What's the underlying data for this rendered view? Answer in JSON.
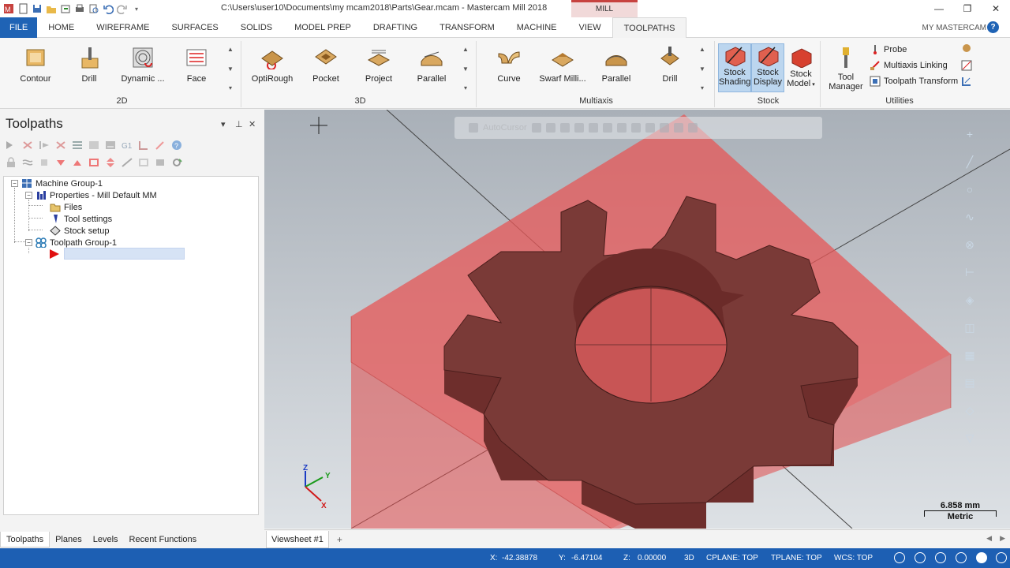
{
  "titlebar": {
    "path": "C:\\Users\\user10\\Documents\\my mcam2018\\Parts\\Gear.mcam - Mastercam Mill 2018",
    "context_tab": "MILL",
    "window_controls": [
      "—",
      "❐",
      "✕"
    ]
  },
  "tabs": [
    "FILE",
    "HOME",
    "WIREFRAME",
    "SURFACES",
    "SOLIDS",
    "MODEL PREP",
    "DRAFTING",
    "TRANSFORM",
    "MACHINE",
    "VIEW",
    "TOOLPATHS"
  ],
  "active_tab": "TOOLPATHS",
  "my_mastercam": "MY MASTERCAM",
  "ribbon": {
    "group_2d": {
      "label": "2D",
      "buttons": [
        "Contour",
        "Drill",
        "Dynamic ...",
        "Face"
      ]
    },
    "group_3d": {
      "label": "3D",
      "buttons": [
        "OptiRough",
        "Pocket",
        "Project",
        "Parallel"
      ]
    },
    "group_multiaxis": {
      "label": "Multiaxis",
      "buttons": [
        "Curve",
        "Swarf Milli...",
        "Parallel",
        "Drill"
      ]
    },
    "group_stock": {
      "label": "Stock",
      "buttons": [
        {
          "line1": "Stock",
          "line2": "Shading"
        },
        {
          "line1": "Stock",
          "line2": "Display"
        },
        {
          "line1": "Stock",
          "line2": "Model"
        }
      ]
    },
    "group_utilities": {
      "label": "Utilities",
      "tool_manager": {
        "line1": "Tool",
        "line2": "Manager"
      },
      "items": [
        "Probe",
        "Multiaxis Linking",
        "Toolpath Transform"
      ]
    }
  },
  "toolpaths_panel": {
    "title": "Toolpaths",
    "controls": [
      "▾",
      "⊥",
      "✕"
    ],
    "tree": {
      "machine_group": "Machine Group-1",
      "properties": "Properties - Mill Default MM",
      "files": "Files",
      "tool_settings": "Tool settings",
      "stock_setup": "Stock setup",
      "toolpath_group": "Toolpath Group-1"
    }
  },
  "bottom_tabs": [
    "Toolpaths",
    "Planes",
    "Levels",
    "Recent Functions"
  ],
  "viewport": {
    "autocursor_label": "AutoCursor",
    "scale_value": "6.858 mm",
    "scale_unit": "Metric",
    "triad": {
      "z": "Z",
      "y": "Y",
      "x": "X"
    }
  },
  "viewsheet": {
    "tab": "Viewsheet #1",
    "add": "+"
  },
  "statusbar": {
    "x_label": "X:",
    "x_value": "-42.38878",
    "y_label": "Y:",
    "y_value": "-6.47104",
    "z_label": "Z:",
    "z_value": "0.00000",
    "mode": "3D",
    "cplane": "CPLANE: TOP",
    "tplane": "TPLANE: TOP",
    "wcs": "WCS: TOP"
  },
  "colors": {
    "brand_blue": "#1d5fb3",
    "stock_red": "#e14a4a",
    "gear_brown": "#7a3a37"
  }
}
